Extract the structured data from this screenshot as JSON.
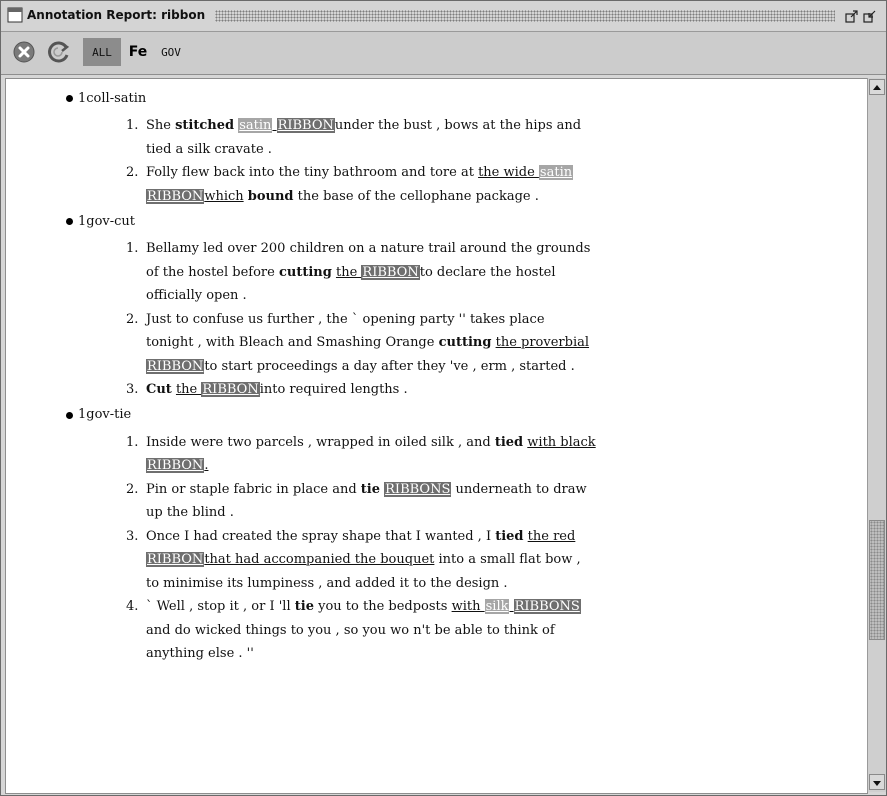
{
  "window": {
    "title": "Annotation Report: ribbon"
  },
  "toolbar": {
    "close_icon": "close-circle-icon",
    "refresh_icon": "refresh-icon",
    "all_label": "ALL",
    "fe_label": "Fe",
    "gov_label": "GOV"
  },
  "report": {
    "senses": [
      {
        "name": "1coll-satin",
        "sentences": [
          {
            "num": "1."
          },
          {
            "num": "2."
          }
        ]
      },
      {
        "name": "1gov-cut",
        "sentences": [
          {
            "num": "1."
          },
          {
            "num": "2."
          },
          {
            "num": "3."
          }
        ]
      },
      {
        "name": "1gov-tie",
        "sentences": [
          {
            "num": "1."
          },
          {
            "num": "2."
          },
          {
            "num": "3."
          },
          {
            "num": "4."
          }
        ]
      }
    ],
    "segments": {
      "s1_1": [
        "She ",
        "stitched",
        " ",
        "satin",
        " ",
        "RIBBON",
        "under the bust , bows at the hips and tied a silk cravate ."
      ],
      "s1_2": [
        "Folly flew back into the tiny bathroom and tore at ",
        "the wide ",
        "satin",
        " ",
        "RIBBON",
        "which",
        " ",
        "bound",
        " the base of the cellophane package ."
      ],
      "s2_1": [
        "Bellamy led over 200 children on a nature trail around the grounds of the hostel before ",
        "cutting",
        " ",
        "the ",
        "RIBBON",
        "to declare the hostel officially open ."
      ],
      "s2_2": [
        "Just to confuse us further , the ` opening party '' takes place tonight , with Bleach and Smashing Orange ",
        "cutting",
        " ",
        "the proverbial ",
        "RIBBON",
        "to start proceedings a day after they 've , erm , started ."
      ],
      "s2_3": [
        "Cut",
        " ",
        "the ",
        "RIBBON",
        "into required lengths ."
      ],
      "s3_1": [
        "Inside were two parcels , wrapped in oiled silk , and ",
        "tied",
        " ",
        "with black ",
        "RIBBON",
        "."
      ],
      "s3_2": [
        "Pin or staple fabric in place and ",
        "tie",
        " ",
        "RIBBONS",
        " underneath to draw up the blind ."
      ],
      "s3_3": [
        "Once I had created the spray shape that I wanted , I ",
        "tied",
        " ",
        "the red ",
        "RIBBON",
        "that had accompanied the bouquet",
        " into a small flat bow , to minimise its lumpiness , and added it to the design ."
      ],
      "s3_4": [
        "` Well , stop it , or I 'll ",
        "tie",
        " you to the bedposts ",
        "with ",
        "silk",
        " ",
        "RIBBONS",
        " and do wicked things to you , so you wo n't be able to think of anything else . ''"
      ]
    }
  }
}
